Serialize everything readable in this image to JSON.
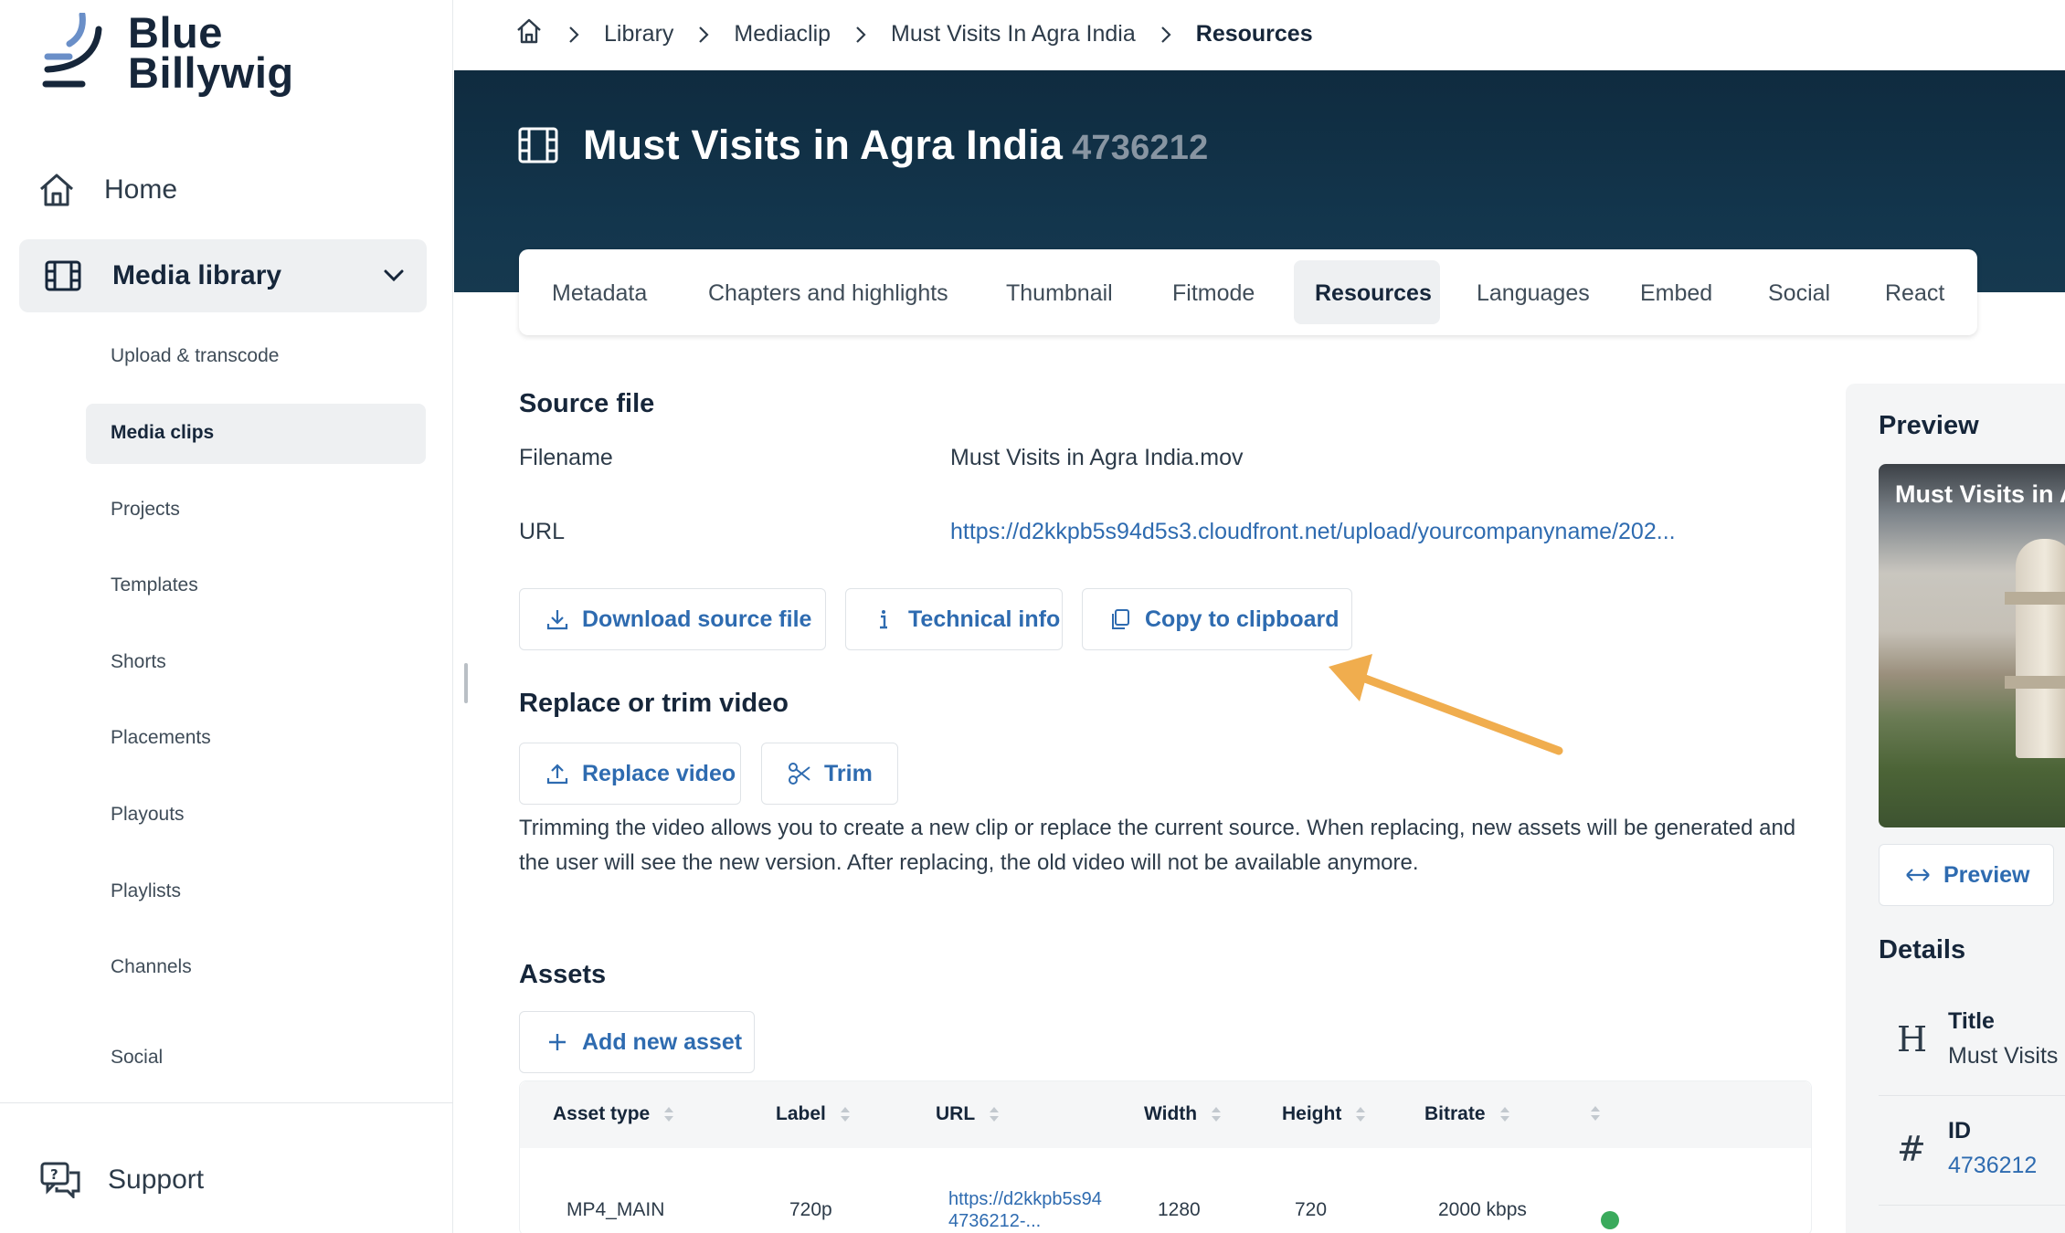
{
  "brand": {
    "line1": "Blue",
    "line2": "Billywig"
  },
  "sidebar": {
    "home": "Home",
    "media_library": "Media library",
    "sub_items": [
      "Upload & transcode",
      "Media clips",
      "Projects",
      "Templates",
      "Shorts",
      "Placements",
      "Playouts",
      "Playlists",
      "Channels",
      "Social"
    ],
    "support": "Support"
  },
  "breadcrumb": [
    "Library",
    "Mediaclip",
    "Must Visits In Agra India",
    "Resources"
  ],
  "header": {
    "title": "Must Visits in Agra India",
    "id": "4736212"
  },
  "tabs": [
    "Metadata",
    "Chapters and highlights",
    "Thumbnail",
    "Fitmode",
    "Resources",
    "Languages",
    "Embed",
    "Social",
    "React"
  ],
  "source_file": {
    "heading": "Source file",
    "filename_label": "Filename",
    "filename_value": "Must Visits in Agra India.mov",
    "url_label": "URL",
    "url_value": "https://d2kkpb5s94d5s3.cloudfront.net/upload/yourcompanyname/202...",
    "buttons": {
      "download": "Download source file",
      "technical": "Technical info",
      "copy": "Copy to clipboard"
    }
  },
  "replace": {
    "heading": "Replace or trim video",
    "replace_btn": "Replace video",
    "trim_btn": "Trim",
    "description": "Trimming the video allows you to create a new clip or replace the current source. When replacing, new assets will be generated and the user will see the new version. After replacing, the old video will not be available anymore."
  },
  "assets": {
    "heading": "Assets",
    "add_btn": "Add new asset",
    "columns": [
      "Asset type",
      "Label",
      "URL",
      "Width",
      "Height",
      "Bitrate"
    ],
    "rows": [
      {
        "type": "MP4_MAIN",
        "label": "720p",
        "url_line1": "https://d2kkpb5s94",
        "url_line2": "4736212-...",
        "width": "1280",
        "height": "720",
        "bitrate": "2000 kbps",
        "status_color": "#3aaa5c"
      }
    ]
  },
  "right_panel": {
    "preview_heading": "Preview",
    "preview_overlay": "Must Visits in A",
    "preview_btn": "Preview",
    "details_heading": "Details",
    "details": [
      {
        "icon": "H",
        "label": "Title",
        "value": "Must Visits"
      },
      {
        "icon": "#",
        "label": "ID",
        "value": "4736212"
      }
    ]
  },
  "colors": {
    "accent": "#2e6bb0",
    "header_bg": "#0f2b3f",
    "annotation_arrow": "#f0ad4e",
    "status_ok": "#3aaa5c"
  }
}
